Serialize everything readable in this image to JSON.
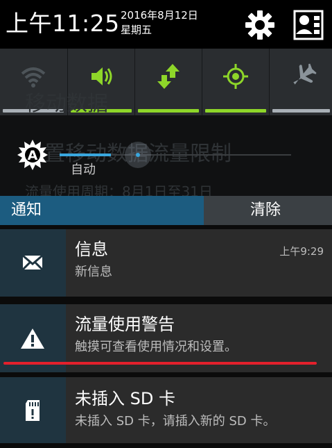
{
  "status": {
    "time": "上午11:25",
    "date": "2016年8月12日",
    "weekday": "星期五"
  },
  "toggles": [
    {
      "name": "wifi",
      "icon": "wifi-icon",
      "active": false
    },
    {
      "name": "sound",
      "icon": "volume-icon",
      "active": true
    },
    {
      "name": "mobile-data",
      "icon": "data-transfer-icon",
      "active": true
    },
    {
      "name": "location",
      "icon": "location-icon",
      "active": true
    },
    {
      "name": "airplane",
      "icon": "airplane-icon",
      "active": false
    }
  ],
  "brightness": {
    "auto_label": "自动",
    "level": 0.35
  },
  "background_text": {
    "line1": "移动数据",
    "line2": "置移动数据流量限制",
    "line3": "流量使用周期：8月1日至31日"
  },
  "notification_header": {
    "label": "通知",
    "clear_label": "清除"
  },
  "notifications": [
    {
      "icon": "envelope-icon",
      "title": "信息",
      "subtitle": "新信息",
      "time": "上午9:29"
    },
    {
      "icon": "warning-icon",
      "title": "流量使用警告",
      "subtitle": "触摸可查看使用情况和设置。",
      "time": ""
    },
    {
      "icon": "sd-card-icon",
      "title": "未插入 SD 卡",
      "subtitle": "未插入 SD 卡，请插入新的 SD 卡。",
      "time": ""
    }
  ],
  "colors": {
    "accent_green": "#8ed629",
    "accent_blue": "#39a7de",
    "inactive_bar": "#a9b0b6",
    "highlight_line": "#e3202c"
  }
}
